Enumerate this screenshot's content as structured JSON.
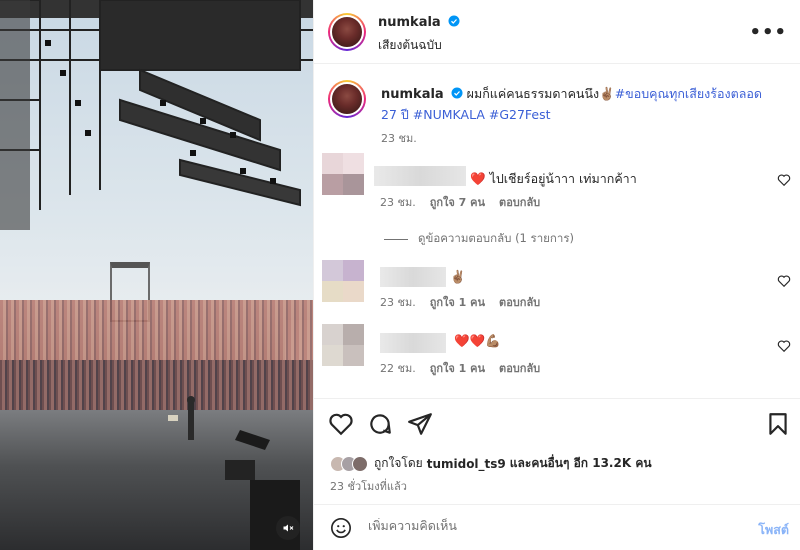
{
  "header": {
    "username": "numkala",
    "subtitle": "เสียงต้นฉบับ",
    "more_icon": "more-horizontal-icon"
  },
  "caption": {
    "username": "numkala",
    "text": "ผมก็แค่คนธรรมดาคนนึง",
    "emoji": "✌🏽",
    "tags": "#ขอบคุณทุกเสียงร้องตลอด 27 ปี #NUMKALA #G27Fest",
    "time": "23 ชม."
  },
  "comments": [
    {
      "emoji": "❤️",
      "text": "ไปเชียร์อยู่น้าาา เท่มากค้าา",
      "time": "23 ชม.",
      "likes": "ถูกใจ 7 คน",
      "reply": "ตอบกลับ"
    },
    {
      "emoji": "✌🏽",
      "text": "",
      "time": "23 ชม.",
      "likes": "ถูกใจ 1 คน",
      "reply": "ตอบกลับ"
    },
    {
      "emoji": "❤️❤️💪🏽",
      "text": "",
      "time": "22 ชม.",
      "likes": "ถูกใจ 1 คน",
      "reply": "ตอบกลับ"
    }
  ],
  "view_replies": "ดูข้อความตอบกลับ (1 รายการ)",
  "likes_line": {
    "prefix": "ถูกใจโดย",
    "user": "tumidol_ts9",
    "suffix": "และคนอื่นๆ อีก 13.2K คน"
  },
  "time_ago": "23 ชั่วโมงที่แล้ว",
  "comment_input": {
    "placeholder": "เพิ่มความคิดเห็น",
    "post_label": "โพสต์"
  },
  "colors": {
    "accent_blue": "#3b5fd6",
    "post_disabled": "#8ab4f8",
    "heart_red": "#e0245e",
    "verified_blue": "#0095f6"
  }
}
